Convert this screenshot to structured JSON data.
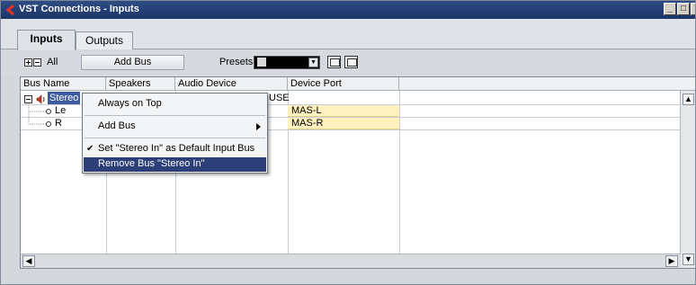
{
  "window": {
    "title": "VST Connections - Inputs",
    "controls": [
      "_",
      "□",
      "×"
    ]
  },
  "tabs": [
    {
      "label": "Inputs",
      "active": true
    },
    {
      "label": "Outputs",
      "active": false
    }
  ],
  "toolbar": {
    "expand_all_label": "All",
    "add_bus_label": "Add Bus",
    "presets_label": "Presets",
    "presets_value": ""
  },
  "table": {
    "columns": [
      "Bus Name",
      "Speakers",
      "Audio Device",
      "Device Port"
    ],
    "rows": [
      {
        "bus_name": "Stereo",
        "speakers": "",
        "audio_device": "USE",
        "device_port": ""
      },
      {
        "bus_name": "Le",
        "speakers": "",
        "audio_device": "",
        "device_port": "MAS-L"
      },
      {
        "bus_name": "R",
        "speakers": "",
        "audio_device": "",
        "device_port": "MAS-R"
      }
    ]
  },
  "context_menu": {
    "items": [
      {
        "label": "Always on Top",
        "checked": false,
        "submenu": false,
        "highlighted": false
      },
      {
        "label": "Add Bus",
        "checked": false,
        "submenu": true,
        "highlighted": false
      },
      {
        "label": "Set \"Stereo In\" as Default Input Bus",
        "checked": true,
        "submenu": false,
        "highlighted": false
      },
      {
        "label": "Remove Bus \"Stereo In\"",
        "checked": false,
        "submenu": false,
        "highlighted": true
      }
    ]
  },
  "colors": {
    "titlebar": "#1c3568",
    "highlight": "#2d3f78",
    "port_cell": "#fff2bf"
  }
}
